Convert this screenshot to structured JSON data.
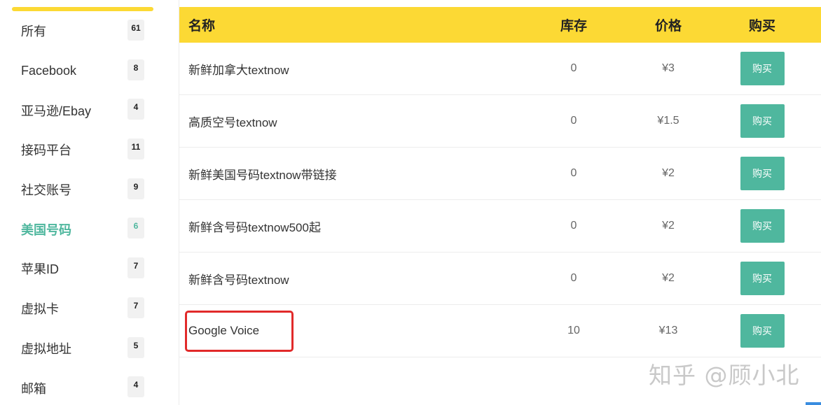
{
  "sidebar": {
    "items": [
      {
        "label": "所有",
        "count": "61",
        "active": false
      },
      {
        "label": "Facebook",
        "count": "8",
        "active": false
      },
      {
        "label": "亚马逊/Ebay",
        "count": "4",
        "active": false
      },
      {
        "label": "接码平台",
        "count": "11",
        "active": false
      },
      {
        "label": "社交账号",
        "count": "9",
        "active": false
      },
      {
        "label": "美国号码",
        "count": "6",
        "active": true
      },
      {
        "label": "苹果ID",
        "count": "7",
        "active": false
      },
      {
        "label": "虚拟卡",
        "count": "7",
        "active": false
      },
      {
        "label": "虚拟地址",
        "count": "5",
        "active": false
      },
      {
        "label": "邮箱",
        "count": "4",
        "active": false
      }
    ]
  },
  "table": {
    "headers": {
      "name": "名称",
      "stock": "库存",
      "price": "价格",
      "buy": "购买"
    },
    "rows": [
      {
        "name": "新鲜加拿大textnow",
        "stock": "0",
        "price": "¥3",
        "button": "购买"
      },
      {
        "name": "高质空号textnow",
        "stock": "0",
        "price": "¥1.5",
        "button": "购买"
      },
      {
        "name": "新鲜美国号码textnow带链接",
        "stock": "0",
        "price": "¥2",
        "button": "购买"
      },
      {
        "name": "新鲜含号码textnow500起",
        "stock": "0",
        "price": "¥2",
        "button": "购买"
      },
      {
        "name": "新鲜含号码textnow",
        "stock": "0",
        "price": "¥2",
        "button": "购买"
      },
      {
        "name": "Google Voice",
        "stock": "10",
        "price": "¥13",
        "button": "购买"
      }
    ]
  },
  "watermark": "知乎 @顾小北",
  "colors": {
    "accent_yellow": "#fcd934",
    "accent_green": "#4fb79e",
    "highlight_red": "#e12a2a"
  }
}
